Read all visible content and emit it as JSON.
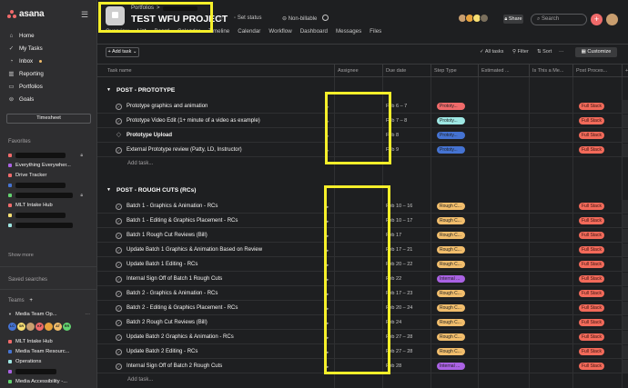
{
  "sidebar": {
    "brand": "asana",
    "nav": [
      {
        "label": "Home",
        "icon": "home-icon"
      },
      {
        "label": "My Tasks",
        "icon": "check-icon"
      },
      {
        "label": "Inbox",
        "icon": "bell-icon"
      },
      {
        "label": "Reporting",
        "icon": "chart-icon"
      },
      {
        "label": "Portfolios",
        "icon": "folder-icon"
      },
      {
        "label": "Goals",
        "icon": "person-icon"
      }
    ],
    "timesheet": "Timesheet",
    "favorites_title": "Favorites",
    "favorites": [
      {
        "label": "",
        "color": "#f06a6a",
        "redacted": true,
        "lock": true
      },
      {
        "label": "Everything Everywher...",
        "color": "#aa62e3",
        "redacted": false,
        "lock": false
      },
      {
        "label": "Drive Tracker",
        "color": "#f06a6a",
        "redacted": false,
        "lock": false
      },
      {
        "label": "",
        "color": "#4573d2",
        "redacted": true,
        "lock": false
      },
      {
        "label": "",
        "color": "#62d26f",
        "redacted": true,
        "lock": true
      },
      {
        "label": "MLT Intake Hub",
        "color": "#f06a6a",
        "redacted": false,
        "lock": false
      },
      {
        "label": "",
        "color": "#f8df72",
        "redacted": true,
        "lock": false
      },
      {
        "label": "",
        "color": "#9ee7e3",
        "redacted": true,
        "lock": false
      }
    ],
    "show_more": "Show more",
    "saved_searches": "Saved searches",
    "teams_title": "Teams",
    "teams_plus": "+",
    "team_name": "Media Team Op...",
    "team_members": [
      {
        "initials": "LC",
        "color": "#4573d2"
      },
      {
        "initials": "SR",
        "color": "#f8df72"
      },
      {
        "initials": "",
        "color": "#c99e6f"
      },
      {
        "initials": "KF",
        "color": "#f06a6a"
      },
      {
        "initials": "",
        "color": "#e8a33d"
      },
      {
        "initials": "AT",
        "color": "#f1bd6c"
      },
      {
        "initials": "RR",
        "color": "#62d26f"
      }
    ],
    "team_projects": [
      {
        "label": "MLT Intake Hub",
        "color": "#f06a6a",
        "redacted": false
      },
      {
        "label": "Media Team Resourc...",
        "color": "#4573d2",
        "redacted": false
      },
      {
        "label": "Operations",
        "color": "#9ee7e3",
        "redacted": false
      },
      {
        "label": "",
        "color": "#aa62e3",
        "redacted": true
      },
      {
        "label": "Media Accessibility -...",
        "color": "#62d26f",
        "redacted": false
      }
    ]
  },
  "header": {
    "crumb": "Portfolios",
    "crumb_sep": ">",
    "title": "TEST WFU PROJECT",
    "set_status": "Set status",
    "non_billable": "Non-billable",
    "tabs": [
      "Overview",
      "List",
      "Board",
      "Calendar",
      "Timeline",
      "Calendar",
      "Workflow",
      "Dashboard",
      "Messages",
      "Files"
    ],
    "share": "Share",
    "search_placeholder": "Search",
    "member_colors": [
      "#c99e6f",
      "#e8a33d",
      "#f8df72",
      "#7a6f5c"
    ]
  },
  "toolbar": {
    "add_task": "Add task",
    "all_tasks": "All tasks",
    "filter": "Filter",
    "sort": "Sort",
    "customize": "Customize"
  },
  "columns": [
    "Task name",
    "Assignee",
    "Due date",
    "Step Type",
    "Estimated ...",
    "Is This a Me...",
    "Post Proces..."
  ],
  "sections": [
    {
      "title": "POST - PROTOTYPE",
      "add": "Add task...",
      "tasks": [
        {
          "name": "Prototype graphics and animation",
          "due": "Feb 6 – 7",
          "step": "Prototy...",
          "step_color": "#f06a6a",
          "post": "Full Stack",
          "bold": false,
          "icon": "check"
        },
        {
          "name": "Prototype Video Edit (1+ minute of a video as example)",
          "due": "Feb 7 – 8",
          "step": "Prototy...",
          "step_color": "#9ee7e3",
          "post": "Full Stack",
          "bold": false,
          "icon": "check"
        },
        {
          "name": "Prototype Upload",
          "due": "Feb 8",
          "step": "Prototy...",
          "step_color": "#4573d2",
          "post": "Full Stack",
          "bold": true,
          "icon": "diamond"
        },
        {
          "name": "External Prototype review (Patty, LD, Instructor)",
          "due": "Feb 9",
          "step": "Prototy...",
          "step_color": "#4573d2",
          "post": "Full Stack",
          "bold": false,
          "icon": "check"
        }
      ]
    },
    {
      "title": "POST - ROUGH CUTS (RCs)",
      "add": "Add task...",
      "tasks": [
        {
          "name": "Batch 1 - Graphics & Animation - RCs",
          "due": "Feb 10 – 16",
          "step": "Rough C...",
          "step_color": "#f1bd6c",
          "post": "Full Stack",
          "bold": false,
          "icon": "check"
        },
        {
          "name": "Batch 1 - Editing & Graphics Placement - RCs",
          "due": "Feb 10 – 17",
          "step": "Rough C...",
          "step_color": "#f1bd6c",
          "post": "Full Stack",
          "bold": false,
          "icon": "check"
        },
        {
          "name": "Batch 1 Rough Cut Reviews (Bill)",
          "due": "Feb 17",
          "step": "Rough C...",
          "step_color": "#f1bd6c",
          "post": "Full Stack",
          "bold": false,
          "icon": "check"
        },
        {
          "name": "Update Batch 1 Graphics & Animation Based on Review",
          "due": "Feb 17 – 21",
          "step": "Rough C...",
          "step_color": "#f1bd6c",
          "post": "Full Stack",
          "bold": false,
          "icon": "check"
        },
        {
          "name": "Update Batch 1 Editing - RCs",
          "due": "Feb 20 – 22",
          "step": "Rough C...",
          "step_color": "#f1bd6c",
          "post": "Full Stack",
          "bold": false,
          "icon": "check"
        },
        {
          "name": "Internal Sign Off of Batch 1 Rough Cuts",
          "due": "Feb 22",
          "step": "Internal ...",
          "step_color": "#aa62e3",
          "post": "Full Stack",
          "bold": false,
          "icon": "check"
        },
        {
          "name": "Batch 2 - Graphics & Animation - RCs",
          "due": "Feb 17 – 23",
          "step": "Rough C...",
          "step_color": "#f1bd6c",
          "post": "Full Stack",
          "bold": false,
          "icon": "check"
        },
        {
          "name": "Batch 2 -  Editing & Graphics Placement - RCs",
          "due": "Feb 20 – 24",
          "step": "Rough C...",
          "step_color": "#f1bd6c",
          "post": "Full Stack",
          "bold": false,
          "icon": "check"
        },
        {
          "name": "Batch 2 Rough Cut Reviews (Bill)",
          "due": "Feb 24",
          "step": "Rough C...",
          "step_color": "#f1bd6c",
          "post": "Full Stack",
          "bold": false,
          "icon": "check"
        },
        {
          "name": "Update Batch 2 Graphics & Animation - RCs",
          "due": "Feb 27 – 28",
          "step": "Rough C...",
          "step_color": "#f1bd6c",
          "post": "Full Stack",
          "bold": false,
          "icon": "check"
        },
        {
          "name": "Update Batch 2 Editing - RCs",
          "due": "Feb 27 – 28",
          "step": "Rough C...",
          "step_color": "#f1bd6c",
          "post": "Full Stack",
          "bold": false,
          "icon": "check"
        },
        {
          "name": "Internal Sign Off of Batch 2 Rough Cuts",
          "due": "Feb 28",
          "step": "Internal ...",
          "step_color": "#aa62e3",
          "post": "Full Stack",
          "bold": false,
          "icon": "check"
        }
      ]
    }
  ],
  "colors": {
    "accent": "#f06a6a",
    "highlight": "#f5ef2a",
    "background": "#1e1f21",
    "sidebar": "#2e2e30"
  }
}
